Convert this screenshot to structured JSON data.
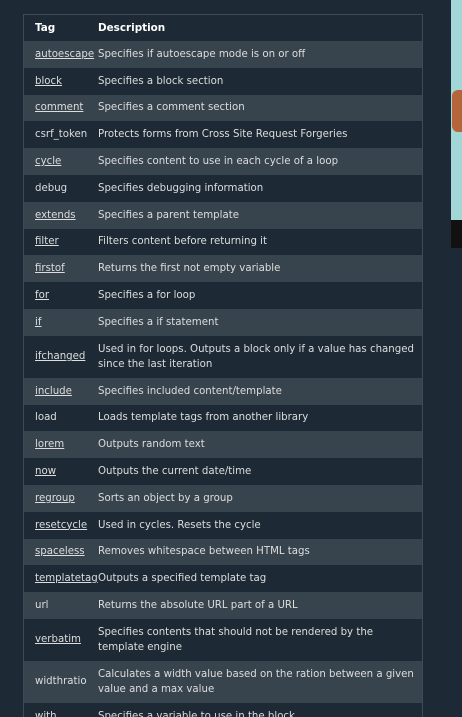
{
  "header": {
    "tag": "Tag",
    "description": "Description"
  },
  "rows": [
    {
      "tag": "autoescape",
      "link": true,
      "description": "Specifies if autoescape mode is on or off"
    },
    {
      "tag": "block",
      "link": true,
      "description": "Specifies a block section"
    },
    {
      "tag": "comment",
      "link": true,
      "description": "Specifies a comment section"
    },
    {
      "tag": "csrf_token",
      "link": false,
      "description": "Protects forms from Cross Site Request Forgeries"
    },
    {
      "tag": "cycle",
      "link": true,
      "description": "Specifies content to use in each cycle of a loop"
    },
    {
      "tag": "debug",
      "link": false,
      "description": "Specifies debugging information"
    },
    {
      "tag": "extends",
      "link": true,
      "description": "Specifies a parent template"
    },
    {
      "tag": "filter",
      "link": true,
      "description": "Filters content before returning it"
    },
    {
      "tag": "firstof",
      "link": true,
      "description": "Returns the first not empty variable"
    },
    {
      "tag": "for",
      "link": true,
      "description": "Specifies a for loop"
    },
    {
      "tag": "if",
      "link": true,
      "description": "Specifies a if statement"
    },
    {
      "tag": "ifchanged",
      "link": true,
      "description": "Used in for loops. Outputs a block only if a value has changed since the last iteration"
    },
    {
      "tag": "include",
      "link": true,
      "description": "Specifies included content/template"
    },
    {
      "tag": "load",
      "link": false,
      "description": "Loads template tags from another library"
    },
    {
      "tag": "lorem",
      "link": true,
      "description": "Outputs random text"
    },
    {
      "tag": "now",
      "link": true,
      "description": "Outputs the current date/time"
    },
    {
      "tag": "regroup",
      "link": true,
      "description": "Sorts an object by a group"
    },
    {
      "tag": "resetcycle",
      "link": true,
      "description": "Used in cycles. Resets the cycle"
    },
    {
      "tag": "spaceless",
      "link": true,
      "description": "Removes whitespace between HTML tags"
    },
    {
      "tag": "templatetag",
      "link": true,
      "description": "Outputs a specified template tag"
    },
    {
      "tag": "url",
      "link": false,
      "description": "Returns the absolute URL part of a URL"
    },
    {
      "tag": "verbatim",
      "link": true,
      "description": "Specifies contents that should not be rendered by the template engine"
    },
    {
      "tag": "widthratio",
      "link": false,
      "description": "Calculates a width value based on the ration between a given value and a max value"
    },
    {
      "tag": "with",
      "link": true,
      "description": "Specifies a variable to use in the block"
    }
  ]
}
